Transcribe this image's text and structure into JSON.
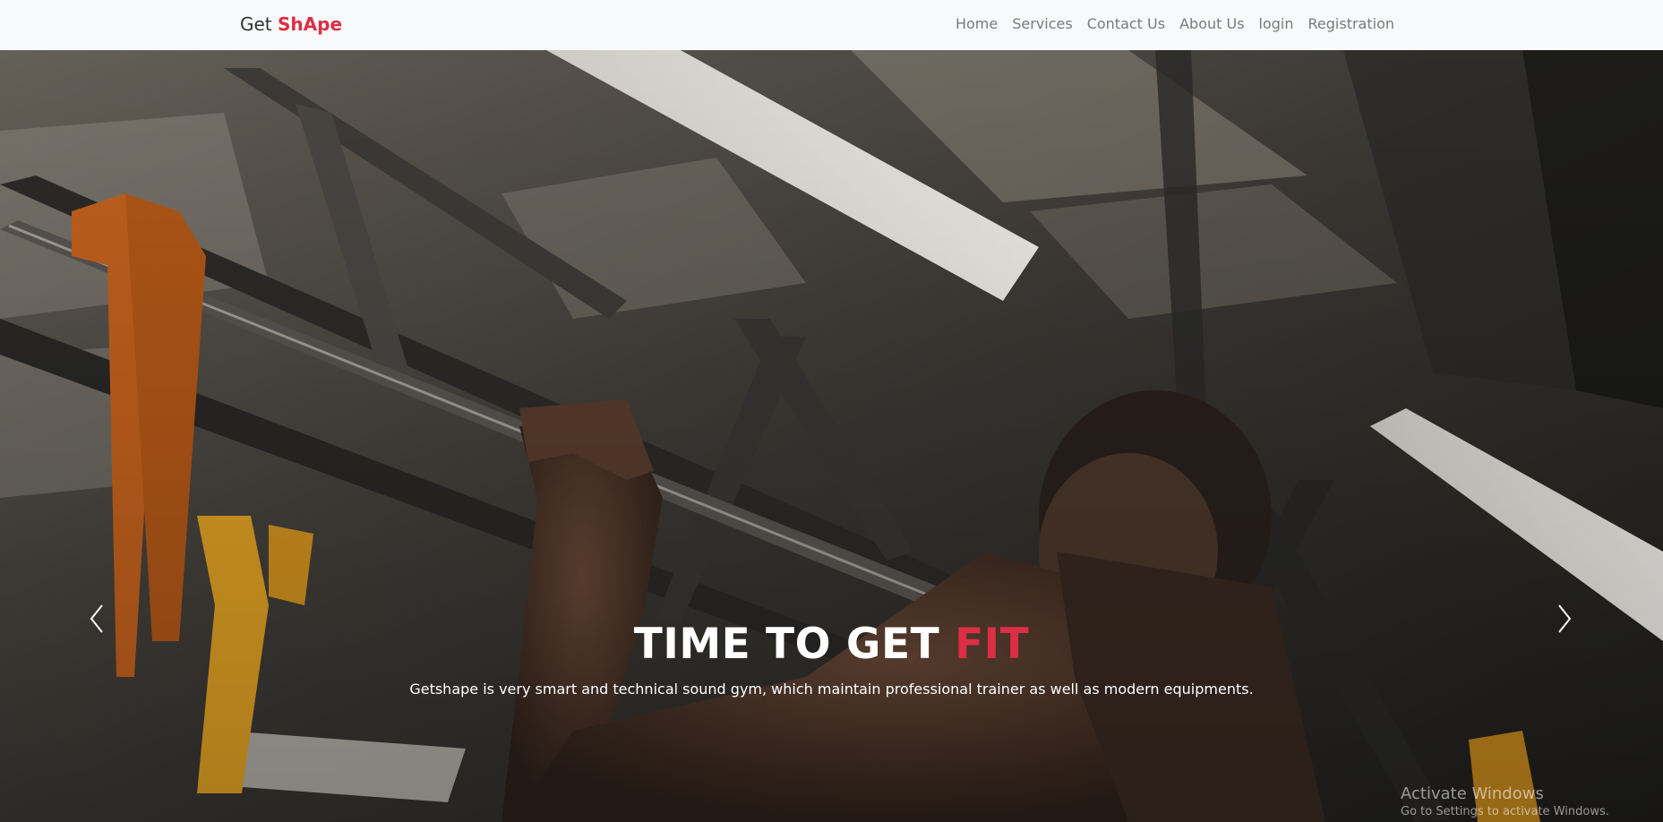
{
  "navbar": {
    "brand_prefix": "Get",
    "brand_accent": "ShApe",
    "links": [
      {
        "label": "Home"
      },
      {
        "label": "Services"
      },
      {
        "label": "Contact Us"
      },
      {
        "label": "About Us"
      },
      {
        "label": "login"
      },
      {
        "label": "Registration"
      }
    ]
  },
  "hero": {
    "title_main": "TIME TO GET",
    "title_accent": "FIT",
    "subtitle": "Getshape is very smart and technical sound gym, which maintain professional trainer as well as modern equipments.",
    "prev_icon": "chevron-left-icon",
    "next_icon": "chevron-right-icon"
  },
  "watermark": {
    "line1": "Activate Windows",
    "line2": "Go to Settings to activate Windows."
  },
  "colors": {
    "accent": "#dc2f45",
    "navbar_bg": "#f8f9fa",
    "nav_link": "#7a7a7a"
  }
}
